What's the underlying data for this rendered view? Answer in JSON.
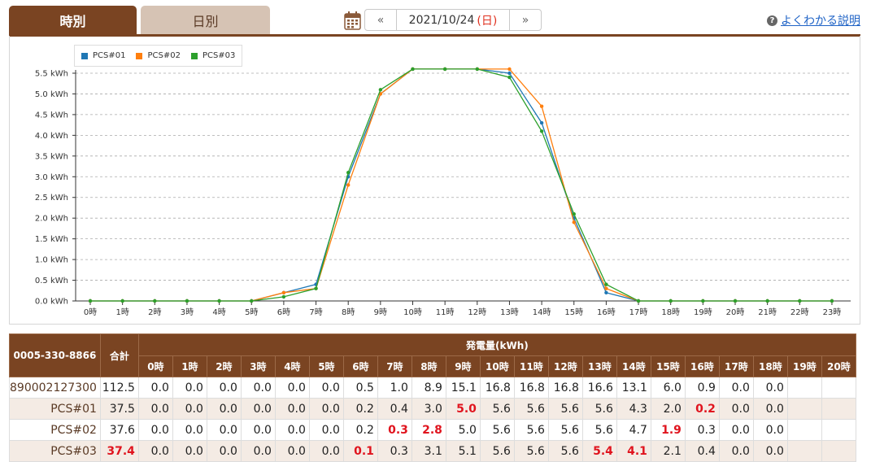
{
  "tabs": {
    "hourly": "時別",
    "daily": "日別"
  },
  "date_nav": {
    "prev": "«",
    "date": "2021/10/24",
    "dow": "(日)",
    "next": "»"
  },
  "help": {
    "label": "よくわかる説明"
  },
  "icons": {
    "calendar": "calendar-icon",
    "help": "question-circle-icon"
  },
  "colors": {
    "brand": "#7a4422",
    "tab_inactive": "#d6c3b4",
    "highlight": "#e0141e",
    "link": "#1f63c6"
  },
  "chart_data": {
    "type": "line",
    "categories": [
      "0時",
      "1時",
      "2時",
      "3時",
      "4時",
      "5時",
      "6時",
      "7時",
      "8時",
      "9時",
      "10時",
      "11時",
      "12時",
      "13時",
      "14時",
      "15時",
      "16時",
      "17時",
      "18時",
      "19時",
      "20時",
      "21時",
      "22時",
      "23時"
    ],
    "y_ticks": [
      "0.0 kWh",
      "0.5 kWh",
      "1.0 kWh",
      "1.5 kWh",
      "2.0 kWh",
      "2.5 kWh",
      "3.0 kWh",
      "3.5 kWh",
      "4.0 kWh",
      "4.5 kWh",
      "5.0 kWh",
      "5.5 kWh"
    ],
    "ylim": [
      0,
      5.5
    ],
    "grid": true,
    "legend_position": "top-left",
    "series": [
      {
        "name": "PCS#01",
        "color": "#1f77b4",
        "values": [
          0,
          0,
          0,
          0,
          0,
          0,
          0.2,
          0.4,
          3.0,
          5.0,
          5.6,
          5.6,
          5.6,
          5.5,
          4.3,
          2.0,
          0.2,
          0,
          0,
          0,
          0,
          0,
          0,
          0
        ]
      },
      {
        "name": "PCS#02",
        "color": "#ff7f0e",
        "values": [
          0,
          0,
          0,
          0,
          0,
          0,
          0.2,
          0.3,
          2.8,
          5.0,
          5.6,
          5.6,
          5.6,
          5.6,
          4.7,
          1.9,
          0.3,
          0,
          0,
          0,
          0,
          0,
          0,
          0
        ]
      },
      {
        "name": "PCS#03",
        "color": "#2ca02c",
        "values": [
          0,
          0,
          0,
          0,
          0,
          0,
          0.1,
          0.3,
          3.1,
          5.1,
          5.6,
          5.6,
          5.6,
          5.4,
          4.1,
          2.1,
          0.4,
          0,
          0,
          0,
          0,
          0,
          0,
          0
        ]
      }
    ]
  },
  "table": {
    "id_header": "0005-330-8866",
    "total_header": "合計",
    "group_header": "発電量(kWh)",
    "hour_headers": [
      "0時",
      "1時",
      "2時",
      "3時",
      "4時",
      "5時",
      "6時",
      "7時",
      "8時",
      "9時",
      "10時",
      "11時",
      "12時",
      "13時",
      "14時",
      "15時",
      "16時",
      "17時",
      "18時",
      "19時",
      "20時"
    ],
    "rows": [
      {
        "name": "890002127300",
        "total": "112.5",
        "total_hl": false,
        "values": [
          "0.0",
          "0.0",
          "0.0",
          "0.0",
          "0.0",
          "0.0",
          "0.5",
          "1.0",
          "8.9",
          "15.1",
          "16.8",
          "16.8",
          "16.8",
          "16.6",
          "13.1",
          "6.0",
          "0.9",
          "0.0",
          "0.0",
          "",
          ""
        ],
        "hl": []
      },
      {
        "name": "PCS#01",
        "total": "37.5",
        "total_hl": false,
        "values": [
          "0.0",
          "0.0",
          "0.0",
          "0.0",
          "0.0",
          "0.0",
          "0.2",
          "0.4",
          "3.0",
          "5.0",
          "5.6",
          "5.6",
          "5.6",
          "5.6",
          "4.3",
          "2.0",
          "0.2",
          "0.0",
          "0.0",
          "",
          ""
        ],
        "hl": [
          9,
          16
        ]
      },
      {
        "name": "PCS#02",
        "total": "37.6",
        "total_hl": false,
        "values": [
          "0.0",
          "0.0",
          "0.0",
          "0.0",
          "0.0",
          "0.0",
          "0.2",
          "0.3",
          "2.8",
          "5.0",
          "5.6",
          "5.6",
          "5.6",
          "5.6",
          "4.7",
          "1.9",
          "0.3",
          "0.0",
          "0.0",
          "",
          ""
        ],
        "hl": [
          7,
          8,
          15
        ]
      },
      {
        "name": "PCS#03",
        "total": "37.4",
        "total_hl": true,
        "values": [
          "0.0",
          "0.0",
          "0.0",
          "0.0",
          "0.0",
          "0.0",
          "0.1",
          "0.3",
          "3.1",
          "5.1",
          "5.6",
          "5.6",
          "5.6",
          "5.4",
          "4.1",
          "2.1",
          "0.4",
          "0.0",
          "0.0",
          "",
          ""
        ],
        "hl": [
          6,
          13,
          14
        ]
      }
    ]
  }
}
